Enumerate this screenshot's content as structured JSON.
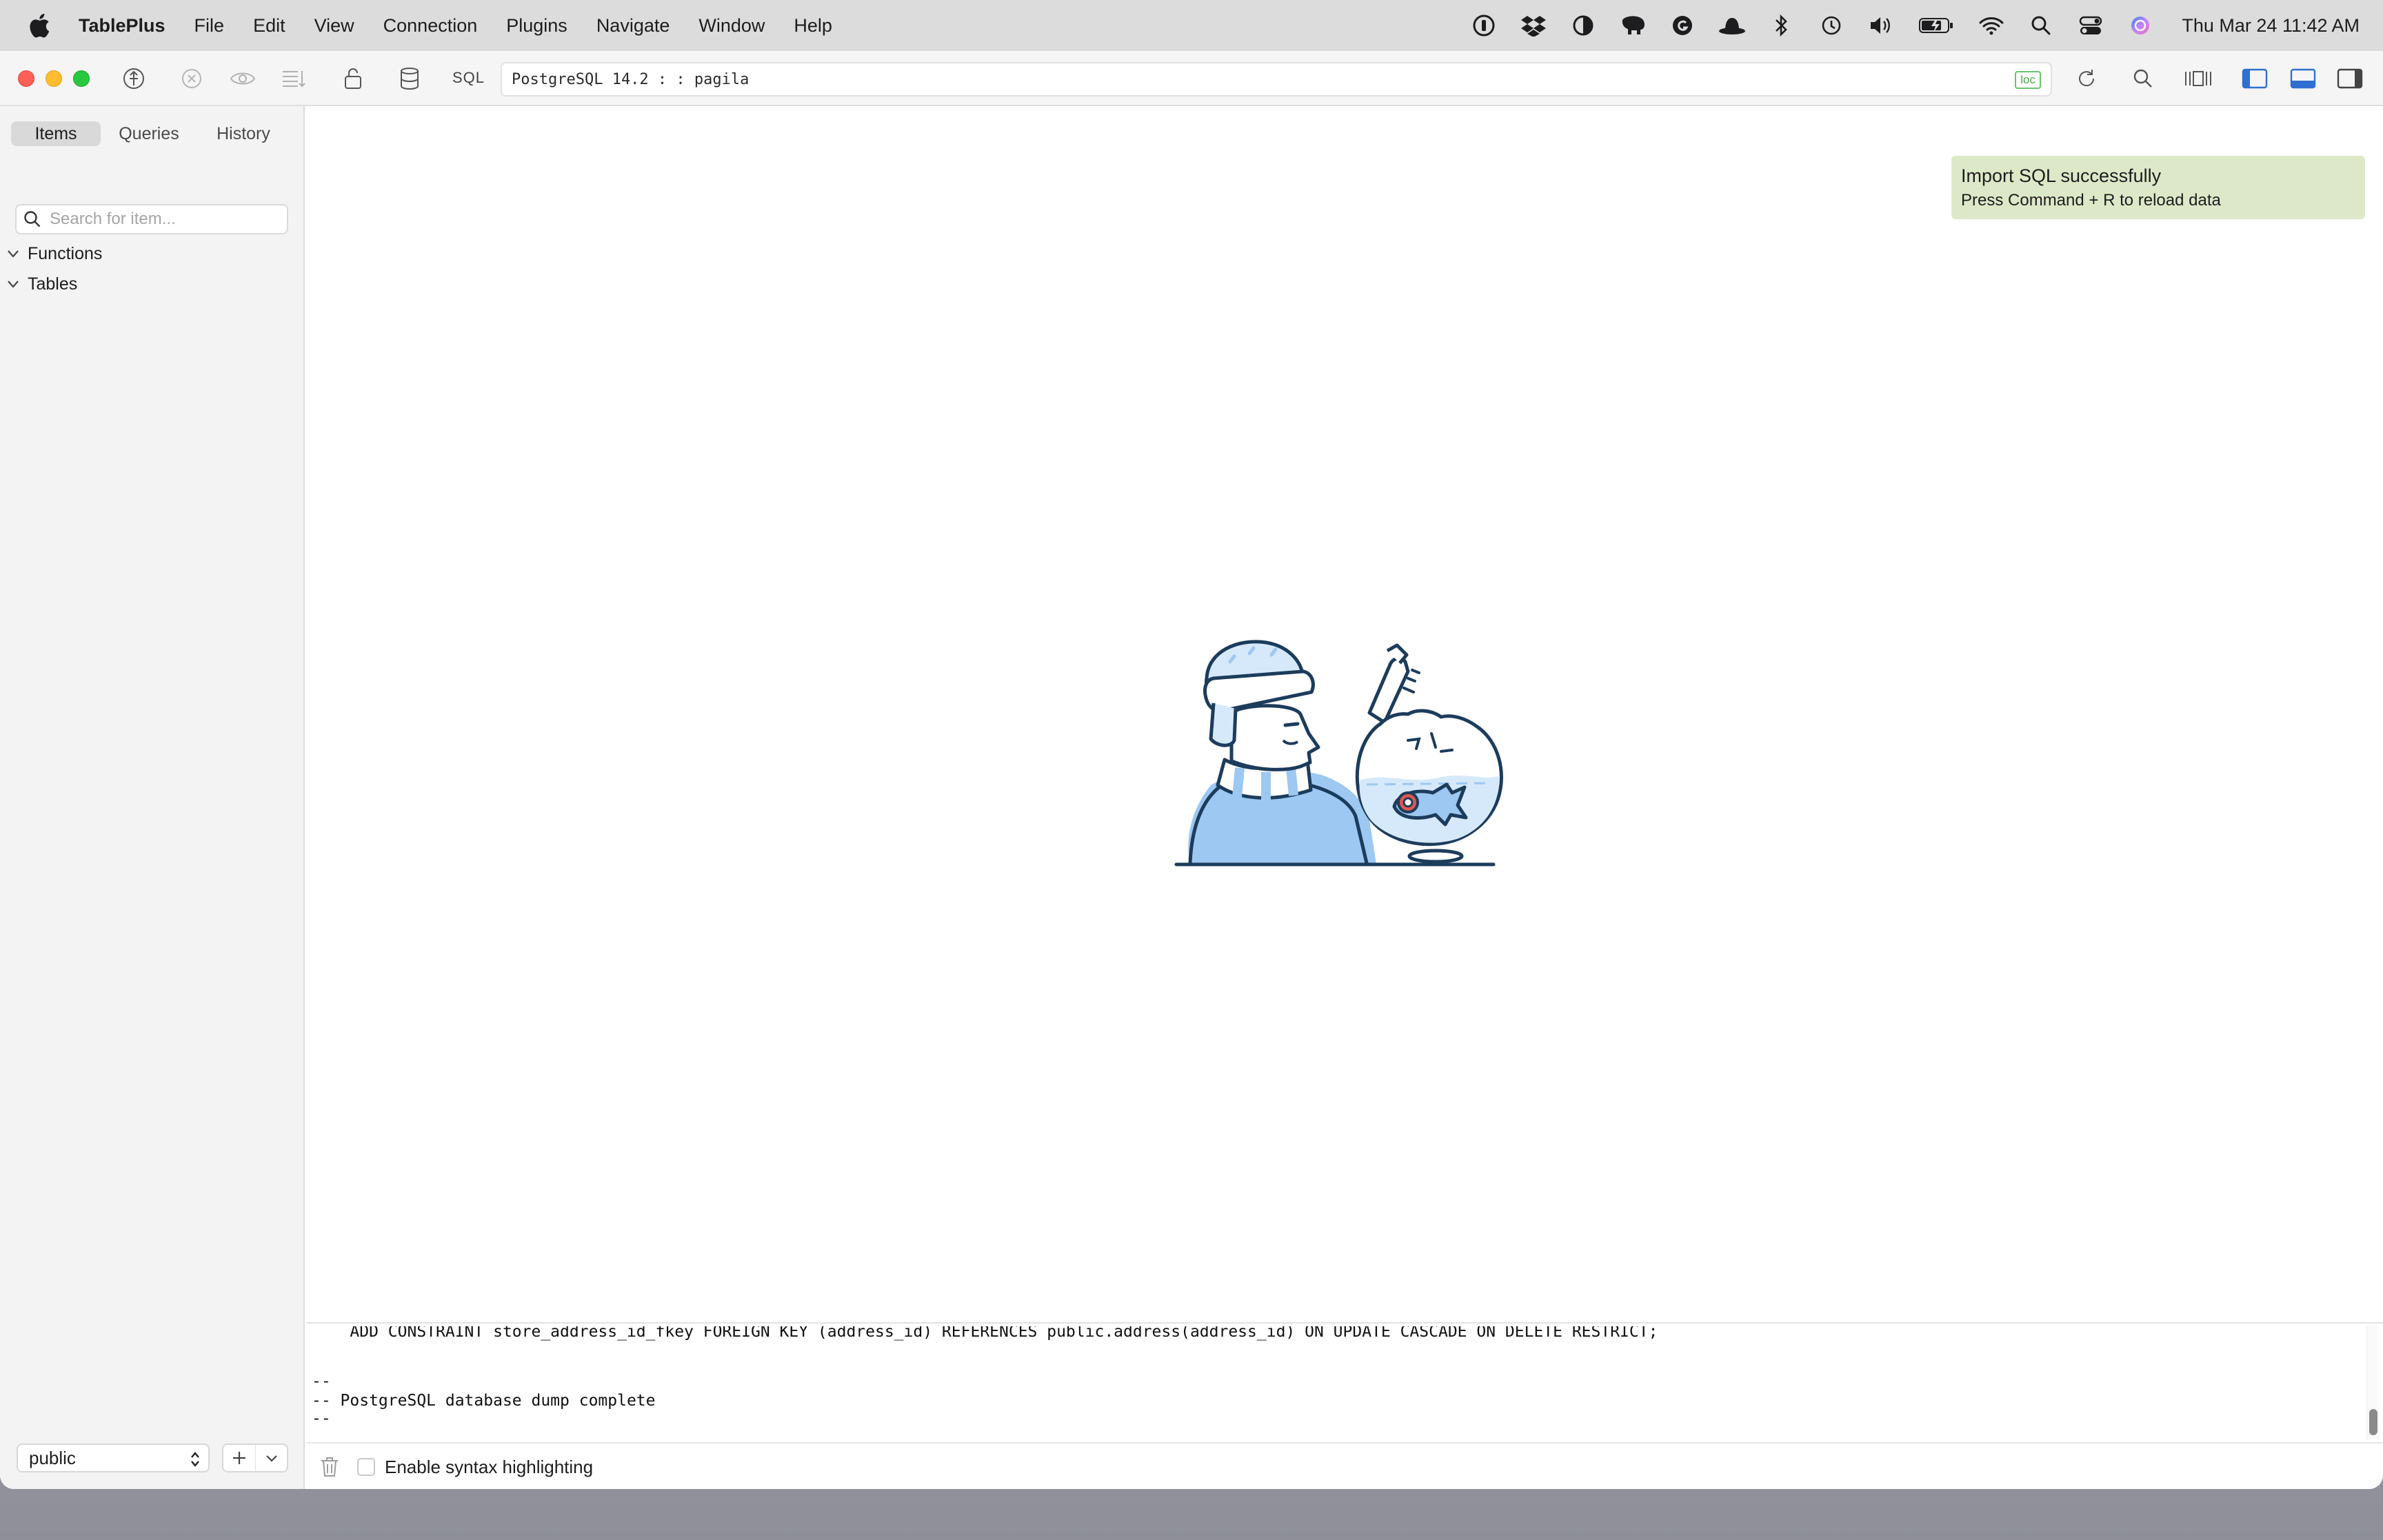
{
  "menubar": {
    "app_name": "TablePlus",
    "items": [
      "File",
      "Edit",
      "View",
      "Connection",
      "Plugins",
      "Navigate",
      "Window",
      "Help"
    ],
    "clock": "Thu Mar 24  11:42 AM"
  },
  "toolbar": {
    "sql_label": "SQL",
    "connection": "PostgreSQL 14.2 :  : pagila",
    "connection_badge": "loc"
  },
  "sidebar": {
    "tabs": [
      "Items",
      "Queries",
      "History"
    ],
    "active_tab": "Items",
    "search_placeholder": "Search for item...",
    "tree": [
      "Functions",
      "Tables"
    ],
    "schema": "public"
  },
  "toast": {
    "title": "Import SQL successfully",
    "message": "Press Command + R to reload data",
    "color": "#dde8c8"
  },
  "console": {
    "lines": [
      "    ADD CONSTRAINT store_address_id_fkey FOREIGN KEY (address_id) REFERENCES public.address(address_id) ON UPDATE CASCADE ON DELETE RESTRICT;",
      "--",
      "-- PostgreSQL database dump complete",
      "--"
    ],
    "syntax_highlight_label": "Enable syntax highlighting",
    "syntax_highlight_checked": false
  },
  "colors": {
    "accent_blue": "#2f6fd1",
    "illustration_fill": "#9cc8f2",
    "illustration_stroke": "#1c3c5c"
  }
}
